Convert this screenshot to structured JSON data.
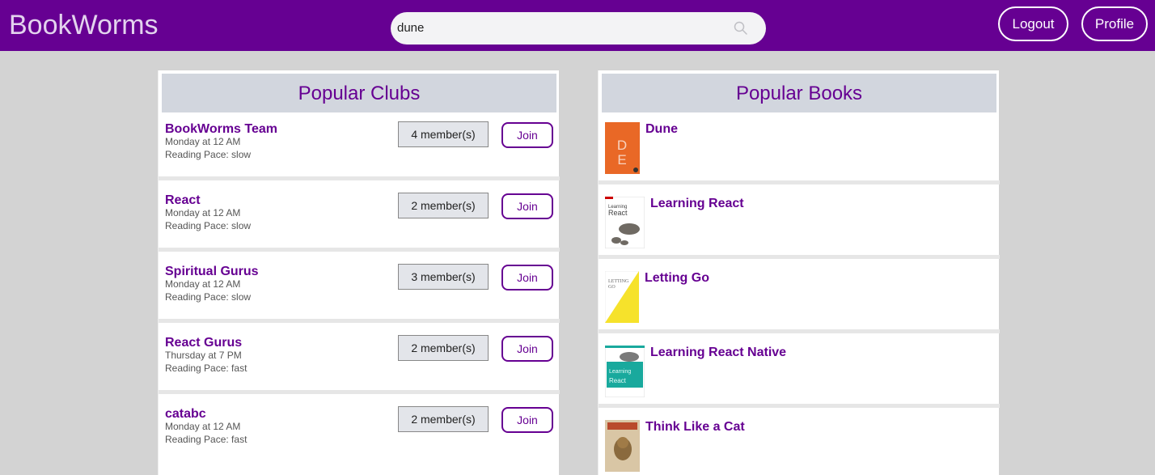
{
  "navbar": {
    "brand": "BookWorms",
    "search": {
      "value": "dune",
      "icon": "search-icon"
    },
    "logout_label": "Logout",
    "profile_label": "Profile"
  },
  "clubs_panel": {
    "title": "Popular Clubs",
    "clubs": [
      {
        "name": "BookWorms Team",
        "schedule": "Monday at 12 AM",
        "pace": "Reading Pace: slow",
        "members": "4 member(s)",
        "join": "Join"
      },
      {
        "name": "React",
        "schedule": "Monday at 12 AM",
        "pace": "Reading Pace: slow",
        "members": "2 member(s)",
        "join": "Join"
      },
      {
        "name": "Spiritual Gurus",
        "schedule": "Monday at 12 AM",
        "pace": "Reading Pace: slow",
        "members": "3 member(s)",
        "join": "Join"
      },
      {
        "name": "React Gurus",
        "schedule": "Thursday at 7 PM",
        "pace": "Reading Pace: fast",
        "members": "2 member(s)",
        "join": "Join"
      },
      {
        "name": "catabc",
        "schedule": "Monday at 12 AM",
        "pace": "Reading Pace: fast",
        "members": "2 member(s)",
        "join": "Join"
      }
    ]
  },
  "books_panel": {
    "title": "Popular Books",
    "books": [
      {
        "title": "Dune",
        "cover": "dune-cover"
      },
      {
        "title": "Learning React",
        "cover": "learning-react-cover"
      },
      {
        "title": "Letting Go",
        "cover": "letting-go-cover"
      },
      {
        "title": "Learning React Native",
        "cover": "learning-react-native-cover"
      },
      {
        "title": "Think Like a Cat",
        "cover": "think-like-a-cat-cover"
      }
    ]
  },
  "colors": {
    "brand_purple": "#660092",
    "page_background": "#d3d3d3",
    "header_gray": "#d2d6de"
  }
}
